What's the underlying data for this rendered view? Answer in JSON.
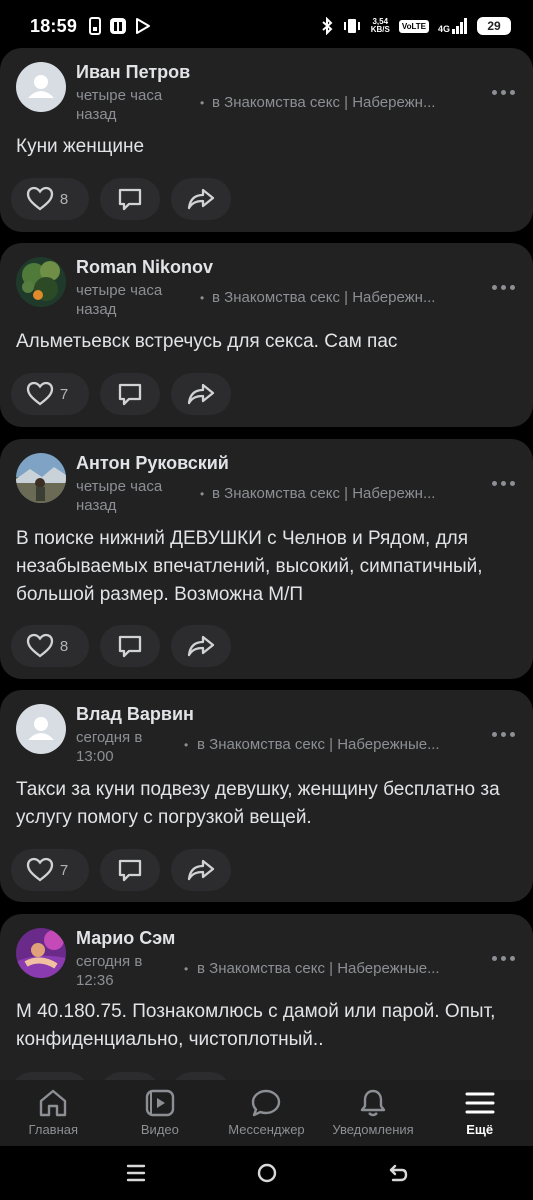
{
  "status": {
    "time": "18:59",
    "speed_top": "3,54",
    "speed_bottom": "KB/S",
    "volte": "VoLTE",
    "net": "4G",
    "battery": "29"
  },
  "posts": [
    {
      "author": "Иван Петров",
      "time": "четыре часа назад",
      "separator": "•",
      "group": "в Знакомства секс | Набережн...",
      "text": "Куни женщине",
      "likes": "8",
      "avatar": "default-avatar-icon"
    },
    {
      "author": "Roman Nikonov",
      "time": "четыре часа назад",
      "separator": "•",
      "group": "в Знакомства секс | Набережн...",
      "text": "Альметьевск встречусь для секса. Сам пас",
      "likes": "7",
      "avatar": "photo-avatar"
    },
    {
      "author": "Антон Руковский",
      "time": "четыре часа назад",
      "separator": "•",
      "group": "в Знакомства секс | Набережн...",
      "text": "В поиске нижний ДЕВУШКИ с Челнов и Рядом, для незабываемых впечатлений, высокий, симпатичный, большой размер. Возможна М/П",
      "likes": "8",
      "avatar": "photo-avatar"
    },
    {
      "author": "Влад Варвин",
      "time": "сегодня в 13:00",
      "separator": "•",
      "group": "в Знакомства секс | Набережные...",
      "text": "Такси за куни подвезу девушку, женщину бесплатно за услугу помогу с погрузкой вещей.",
      "likes": "7",
      "avatar": "default-avatar-icon"
    },
    {
      "author": "Марио Сэм",
      "time": "сегодня в 12:36",
      "separator": "•",
      "group": "в Знакомства секс | Набережные...",
      "text": "М 40.180.75. Познакомлюсь с дамой или парой. Опыт, конфиденциально, чистоплотный..",
      "likes": "",
      "avatar": "photo-avatar"
    }
  ],
  "nav": {
    "items": [
      {
        "label": "Главная",
        "icon": "home-icon"
      },
      {
        "label": "Видео",
        "icon": "video-icon"
      },
      {
        "label": "Мессенджер",
        "icon": "messenger-icon"
      },
      {
        "label": "Уведомления",
        "icon": "bell-icon"
      },
      {
        "label": "Ещё",
        "icon": "menu-icon"
      }
    ]
  },
  "colors": {
    "background": "#000000",
    "card": "#222222",
    "button": "#2c2c2e",
    "text": "#e1e3e6",
    "secondary_text": "#8c8f94"
  }
}
